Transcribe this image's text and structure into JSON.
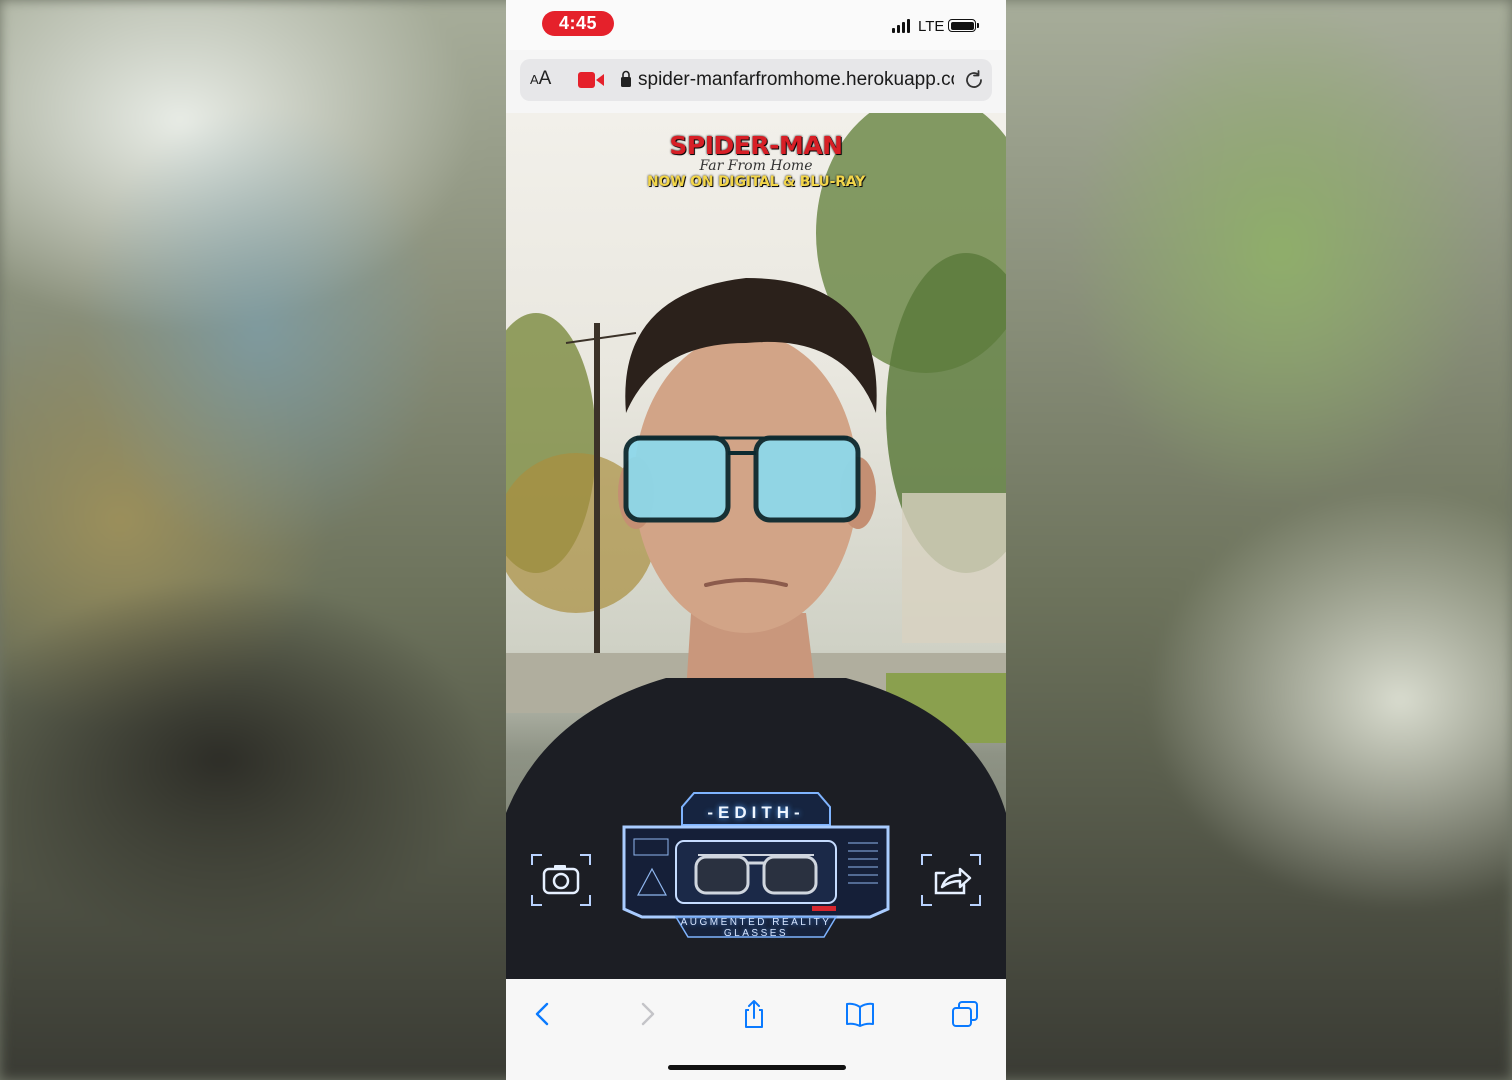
{
  "status_bar": {
    "time": "4:45",
    "network": "LTE"
  },
  "browser": {
    "text_size_button": {
      "small": "A",
      "large": "A"
    },
    "url": "spider-manfarfromhome.herokuapp.com"
  },
  "ar_view": {
    "poster": {
      "title": "SPIDER-MAN",
      "subtitle": "Far From Home",
      "tagline": "NOW ON DIGITAL & BLU-RAY"
    },
    "hud": {
      "title": "-EDITH-",
      "subtitle_line1": "AUGMENTED REALITY",
      "subtitle_line2": "GLASSES"
    }
  },
  "toolbar": {
    "items": [
      "back",
      "forward",
      "share",
      "bookmarks",
      "tabs"
    ]
  },
  "colors": {
    "recording_red": "#e5212b",
    "safari_blue": "#0a7aff",
    "hud_blue": "#4fa3ff"
  }
}
